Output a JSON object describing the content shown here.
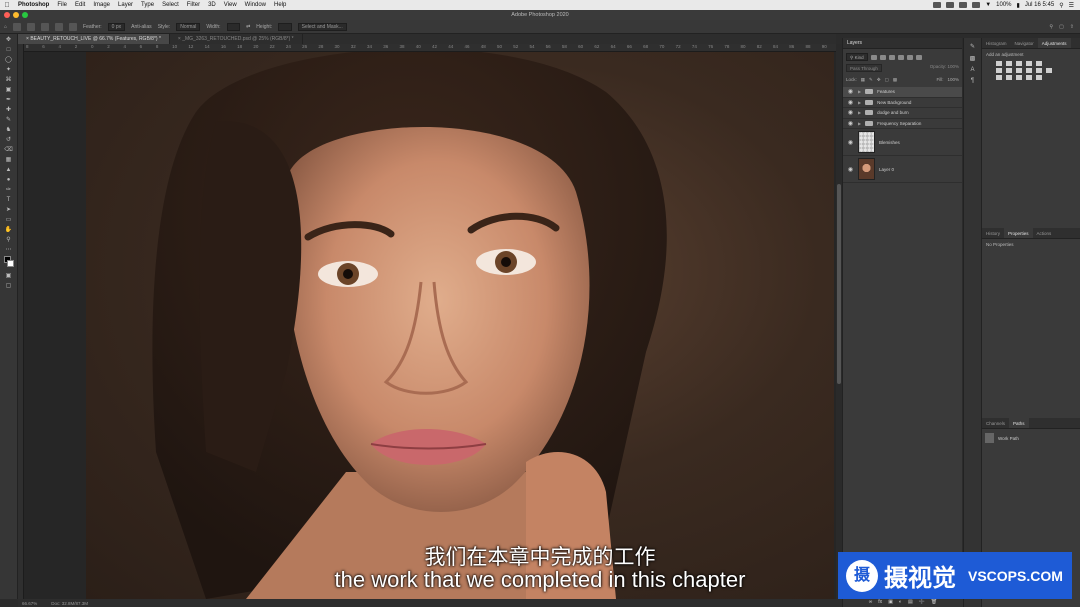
{
  "menubar": {
    "items": [
      "Photoshop",
      "File",
      "Edit",
      "Image",
      "Layer",
      "Type",
      "Select",
      "Filter",
      "3D",
      "View",
      "Window",
      "Help"
    ],
    "battery": "100%",
    "clock": "Jul 16  5:45"
  },
  "window": {
    "title": "Adobe Photoshop 2020"
  },
  "options": {
    "feather_label": "Feather:",
    "feather_value": "0 px",
    "antialias": "Anti-alias",
    "style_label": "Style:",
    "style_value": "Normal",
    "width_label": "Width:",
    "height_label": "Height:",
    "select_mask": "Select and Mask..."
  },
  "tabs": [
    {
      "label": "BEAUTY_RETOUCH_LIVE @ 66.7% (Features, RGB/8*) *",
      "active": true
    },
    {
      "label": "_MG_3263_RETOUCHED.psd @ 25% (RGB/8*) *",
      "active": false
    }
  ],
  "ruler_ticks": [
    "8",
    "6",
    "4",
    "2",
    "0",
    "2",
    "4",
    "6",
    "8",
    "10",
    "12",
    "14",
    "16",
    "18",
    "20",
    "22",
    "24",
    "26",
    "28",
    "30",
    "32",
    "34",
    "36",
    "38",
    "40",
    "42",
    "44",
    "46",
    "48",
    "50",
    "52",
    "54",
    "56",
    "58",
    "60",
    "62",
    "64",
    "66",
    "68",
    "70",
    "72",
    "74",
    "76",
    "78",
    "80",
    "82",
    "84",
    "86",
    "88",
    "90"
  ],
  "status": {
    "zoom": "66.67%",
    "doc": "Doc: 32.8M/87.3M"
  },
  "layers_panel": {
    "title": "Layers",
    "filter_kind": "Kind",
    "blend_mode": "Pass Through",
    "opacity_label": "Opacity:",
    "opacity_value": "100%",
    "lock_label": "Lock:",
    "fill_label": "Fill:",
    "fill_value": "100%",
    "layers": [
      {
        "name": "Features",
        "type": "group",
        "selected": true
      },
      {
        "name": "New Background",
        "type": "group",
        "selected": false
      },
      {
        "name": "dodge and burn",
        "type": "group",
        "selected": false
      },
      {
        "name": "Frequency Separation",
        "type": "group",
        "selected": false
      },
      {
        "name": "Blemishes",
        "type": "pixel-empty",
        "selected": false
      },
      {
        "name": "Layer 0",
        "type": "pixel-photo",
        "selected": false
      }
    ]
  },
  "right_top": {
    "tabs": [
      "Histogram",
      "Navigator",
      "Adjustments"
    ],
    "active": "Adjustments",
    "hint": "Add an adjustment"
  },
  "right_mid": {
    "tabs": [
      "History",
      "Properties",
      "Actions"
    ],
    "active": "Properties",
    "text": "No Properties"
  },
  "right_bottom": {
    "tabs": [
      "Channels",
      "Paths"
    ],
    "active": "Paths",
    "path_name": "Work Path"
  },
  "subtitles": {
    "cn": "我们在本章中完成的工作",
    "en": "the work that we completed in this chapter"
  },
  "watermark": {
    "cn": "摄视觉",
    "en": "VSCOPS.COM",
    "logo": "摄"
  },
  "colors": {
    "accent": "#1e5bd6",
    "panel": "#3a3a3a",
    "canvas_bg": "#262626"
  }
}
